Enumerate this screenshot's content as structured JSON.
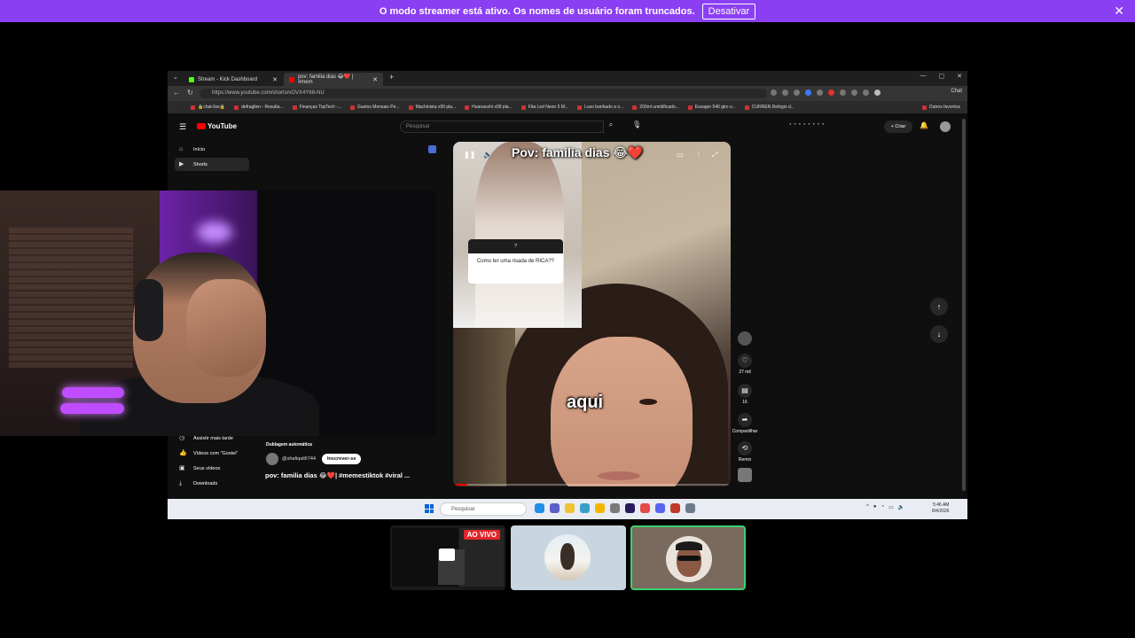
{
  "banner": {
    "message": "O modo streamer está ativo. Os nomes de usuário foram truncados.",
    "button_label": "Desativar",
    "close_glyph": "✕",
    "color": "#8b3ff2"
  },
  "browser": {
    "tabs": [
      {
        "label": "Stream - Kick Dashboard",
        "icon": "kick-icon",
        "color": "#53fc18"
      },
      {
        "label": "pov: familia dias 😂❤️ | #mem",
        "icon": "youtube-icon",
        "color": "#ff0000"
      }
    ],
    "url": "https://www.youtube.com/shorts/vOVX4Y68-NU",
    "chat_label": "Chat",
    "bookmarks": [
      "🔒chat-live🔒",
      "defragllen - Resulta...",
      "Finanças TopTech -...",
      "Gastos Mensais Pe...",
      "Machinista x99 pla...",
      "Huananzhi x99 pla...",
      "Fita Led Neon 5 M...",
      "Luxo banhado a o...",
      "200ml umidificado...",
      "Essager 540 giro o...",
      "CURREN Relógio d..."
    ],
    "other_favorites": "Outros favoritos"
  },
  "youtube": {
    "logo_text": "YouTube",
    "search_placeholder": "Pesquisar",
    "create_label": "Criar",
    "sidebar": [
      {
        "label": "Início",
        "icon": "home-icon"
      },
      {
        "label": "Shorts",
        "icon": "shorts-icon",
        "active": true
      }
    ],
    "sidebar_bottom": [
      {
        "label": "Assistir mais tarde",
        "icon": "clock-icon"
      },
      {
        "label": "Vídeos com \"Gostei\"",
        "icon": "thumb-up-icon"
      },
      {
        "label": "Seus vídeos",
        "icon": "video-icon"
      },
      {
        "label": "Downloads",
        "icon": "download-icon"
      }
    ],
    "short": {
      "overlay_title": "Pov: familia dias 😂❤️",
      "caption": "aqui",
      "question_card": "Como ter uma risada de RICA??",
      "progress": 0.05
    },
    "actions": {
      "likes": "27 mil",
      "comments": "16",
      "share": "Compartilhar",
      "remix": "Remix"
    },
    "meta": {
      "dub_label": "Dublagem automática",
      "channel": "@shafiqali6744",
      "subscribe_label": "Inscrever-se",
      "title": "pov: familia dias 😂❤️| #memestiktok #viral ..."
    }
  },
  "taskbar": {
    "search_placeholder": "Pesquisar",
    "time": "5:46 AM",
    "date": "8/4/2026"
  },
  "participants": {
    "live_badge": "AO VIVO"
  }
}
